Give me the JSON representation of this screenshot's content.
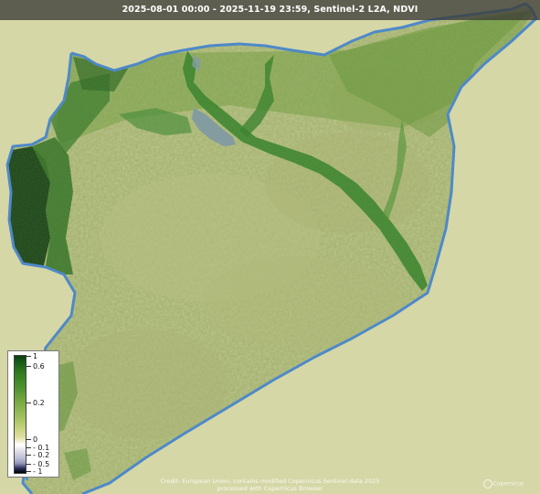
{
  "title": "2025-08-01 00:00 - 2025-11-19 23:59, Sentinel-2 L2A, NDVI",
  "legend": {
    "labels": [
      "1",
      "0.6",
      "0.2",
      "0",
      "- 0.1",
      "- 0.2",
      "- 0.5",
      "- 1"
    ],
    "values": [
      1,
      0.6,
      0.2,
      0,
      -0.1,
      -0.2,
      -0.5,
      -1
    ]
  },
  "attribution": {
    "line1": "Credit: European Union, contains modified Copernicus Sentinel data 2025",
    "line2": "processed with Copernicus Browser"
  },
  "logo": {
    "text": "Copernicus"
  },
  "colors": {
    "background": "#d6d7a7",
    "land": "#9dab64",
    "vegetation_dark": "#1f5e1f",
    "vegetation_mid": "#3e8a2e",
    "border": "#4e89c8",
    "lake": "#7c96a4"
  }
}
